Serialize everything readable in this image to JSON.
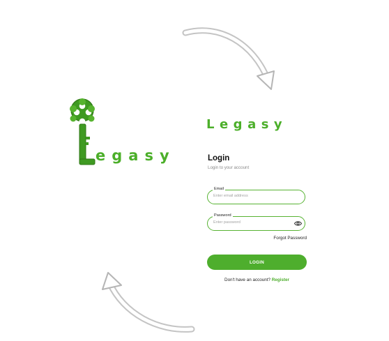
{
  "splash": {
    "logo_text": "egasy",
    "logo_icon": "key-logo-icon"
  },
  "login": {
    "brand": "Legasy",
    "title": "Login",
    "subtitle": "Login to your account",
    "email": {
      "label": "Email",
      "placeholder": "Enter email address",
      "value": ""
    },
    "password": {
      "label": "Password",
      "placeholder": "Enter password",
      "value": "",
      "toggle_icon": "eye-icon"
    },
    "forgot_label": "Forgot Password",
    "login_button": "LOGIN",
    "register_prompt": "Don't have an account?",
    "register_link": "Register"
  },
  "colors": {
    "brand_green": "#4caf2a",
    "arrow_gray": "#c9c9c9"
  },
  "decor": {
    "arrow_icon": "curved-arrow-icon"
  }
}
